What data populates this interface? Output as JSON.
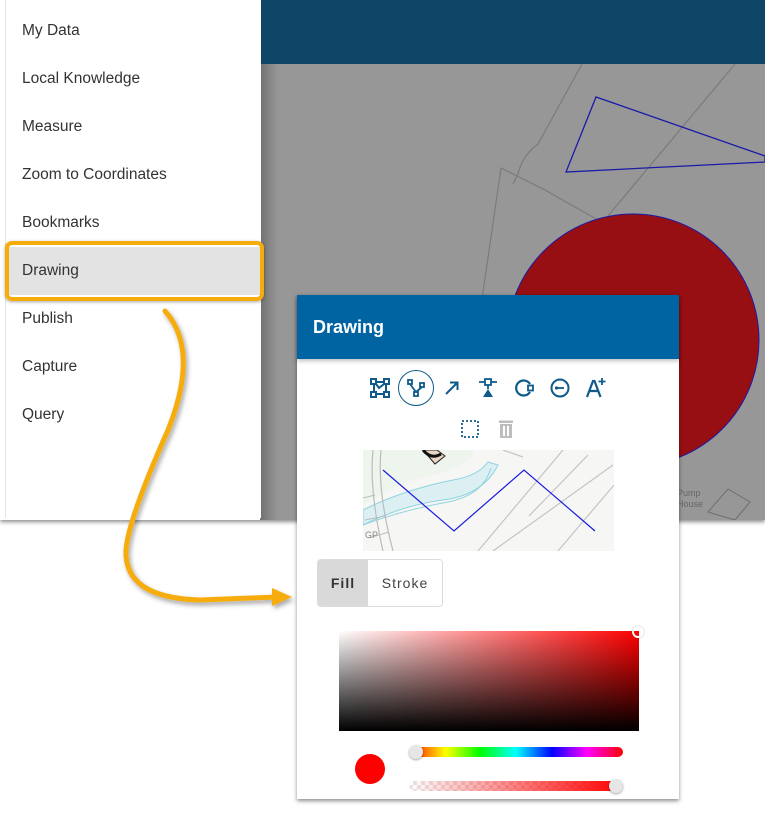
{
  "sidebar": {
    "items": [
      {
        "label": "My Data",
        "active": false
      },
      {
        "label": "Local Knowledge",
        "active": false
      },
      {
        "label": "Measure",
        "active": false
      },
      {
        "label": "Zoom to Coordinates",
        "active": false
      },
      {
        "label": "Bookmarks",
        "active": false
      },
      {
        "label": "Drawing",
        "active": true
      },
      {
        "label": "Publish",
        "active": false
      },
      {
        "label": "Capture",
        "active": false
      },
      {
        "label": "Query",
        "active": false
      }
    ]
  },
  "map": {
    "labels": [
      "Pump",
      "House"
    ],
    "features": {
      "triangle_stroke": "#1a1aa8",
      "circle_fill": "#970f13",
      "circle_stroke": "#1a1aa8"
    }
  },
  "panel": {
    "title": "Drawing",
    "tools": [
      {
        "icon": "edit-vertices-icon",
        "label": "Edit vertices",
        "selected": false
      },
      {
        "icon": "polyline-icon",
        "label": "Polyline",
        "selected": true
      },
      {
        "icon": "arrow-icon",
        "label": "Arrow",
        "selected": false
      },
      {
        "icon": "point-marker-icon",
        "label": "Point",
        "selected": false
      },
      {
        "icon": "rotate-icon",
        "label": "Rotate",
        "selected": false
      },
      {
        "icon": "circle-radius-icon",
        "label": "Circle",
        "selected": false
      },
      {
        "icon": "text-add-icon",
        "label": "Text",
        "selected": false
      }
    ],
    "secondary_tools": [
      {
        "icon": "select-area-icon",
        "label": "Select",
        "enabled": true
      },
      {
        "icon": "trash-icon",
        "label": "Delete",
        "enabled": false
      }
    ],
    "preview_label": "GP",
    "style_tabs": [
      {
        "label": "Fill",
        "selected": true
      },
      {
        "label": "Stroke",
        "selected": false
      }
    ],
    "color": {
      "current": "#ff0000",
      "hue_deg": 0,
      "saturation": 1.0,
      "brightness": 1.0,
      "alpha": 1.0
    }
  },
  "colors": {
    "accent": "#0064a3",
    "topbar": "#0f4566",
    "highlight": "#f6ac0b",
    "icon": "#0f5a8a"
  }
}
